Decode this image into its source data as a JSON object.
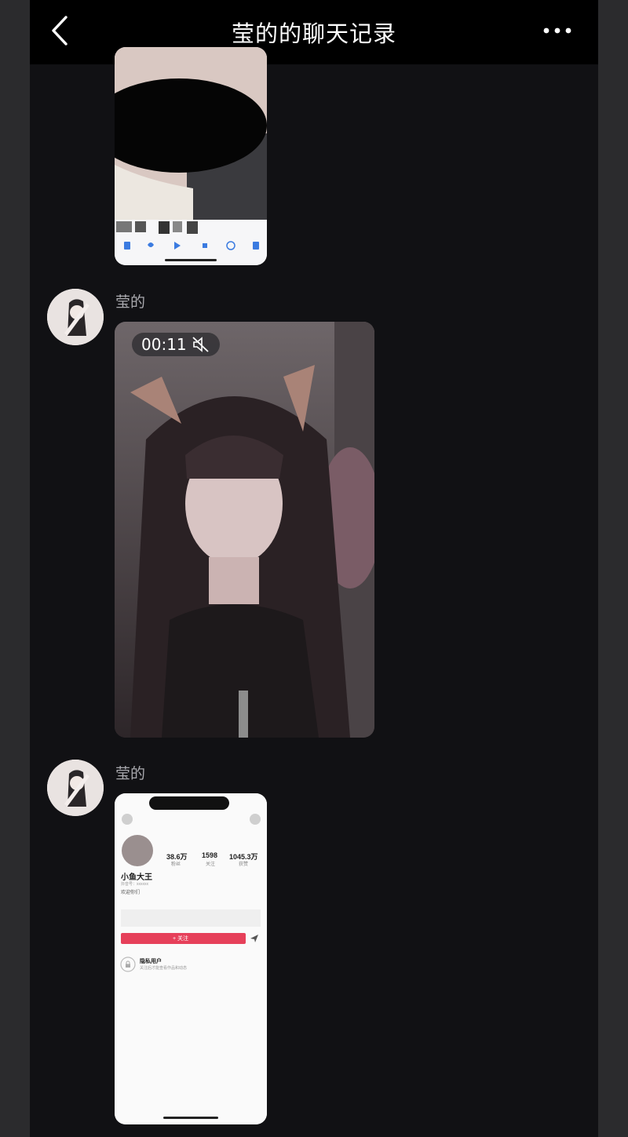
{
  "header": {
    "title": "莹的的聊天记录"
  },
  "messages": [
    {
      "type": "image-screenshot"
    },
    {
      "type": "video",
      "sender": "莹的",
      "duration": "00:11"
    },
    {
      "type": "image-screenshot",
      "sender": "莹的",
      "profile": {
        "followers": "38.6万",
        "followers_label": "粉丝",
        "following": "1598",
        "following_label": "关注",
        "likes": "1045.3万",
        "likes_label": "获赞",
        "name": "小鱼大王",
        "id_line": "抖音号：xxxxxx",
        "bio": "欢迎你们",
        "follow_label": "+ 关注",
        "private_title": "隐私用户",
        "private_desc": "关注后才能查看作品和动态"
      }
    }
  ],
  "colors": {
    "nav_bg": "#000000",
    "chat_bg": "#111114",
    "follow_red": "#e6405a"
  }
}
